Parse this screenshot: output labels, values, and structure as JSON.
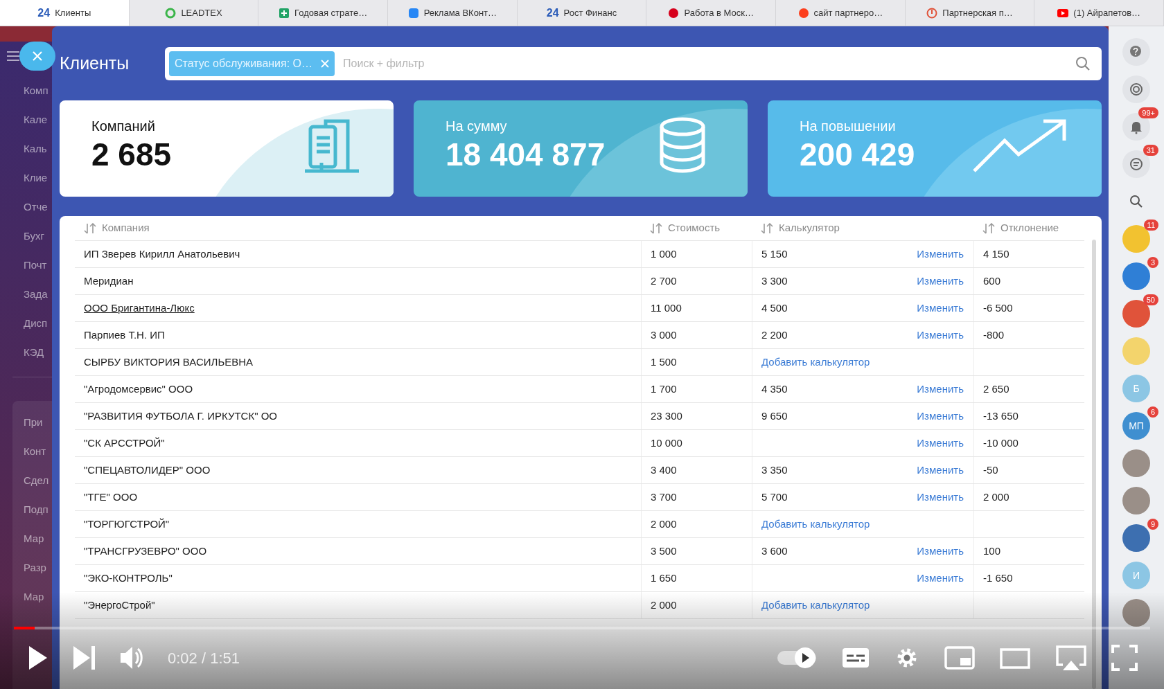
{
  "browser_tabs": [
    {
      "label": "Клиенты",
      "kind": "b24",
      "icon_text": "24",
      "selected": true
    },
    {
      "label": "LEADTEX",
      "kind": "ring",
      "selected": false
    },
    {
      "label": "Годовая страте…",
      "kind": "sheet",
      "selected": false
    },
    {
      "label": "Реклама ВКонт…",
      "kind": "vk",
      "selected": false
    },
    {
      "label": "Рост Финанс",
      "kind": "b24",
      "icon_text": "24",
      "selected": false
    },
    {
      "label": "Работа в Моск…",
      "kind": "hh",
      "selected": false
    },
    {
      "label": "сайт партнеро…",
      "kind": "yandex",
      "selected": false
    },
    {
      "label": "Партнерская п…",
      "kind": "partner",
      "selected": false
    },
    {
      "label": "(1) Айрапетов…",
      "kind": "youtube",
      "selected": false
    }
  ],
  "sidebar": {
    "groups": [
      {
        "kind": "main",
        "items": [
          "Комп",
          "Кале",
          "Каль",
          "Клие",
          "Отче",
          "Бухг",
          "Почт",
          "Зада",
          "Дисп",
          "КЭД"
        ]
      },
      {
        "kind": "boxed",
        "items": [
          "При",
          "Конт",
          "Сдел",
          "Подп",
          "Мар",
          "Разр",
          "Мар"
        ]
      }
    ]
  },
  "panel": {
    "title": "Клиенты",
    "filter_chip": "Статус обслуживания: О…",
    "search": {
      "placeholder": "Поиск + фильтр"
    }
  },
  "cards": [
    {
      "kind": "companies",
      "label": "Компаний",
      "value": "2 685"
    },
    {
      "kind": "sum",
      "label": "На сумму",
      "value": "18 404 877"
    },
    {
      "kind": "growth",
      "label": "На повышении",
      "value": "200 429"
    }
  ],
  "table": {
    "columns": [
      "Компания",
      "Стоимость",
      "Калькулятор",
      "Отклонение"
    ],
    "rows": [
      {
        "company": "ИП Зверев Кирилл Анатольевич",
        "cost": "1 000",
        "calculator": {
          "kind": "edit",
          "value": "5 150",
          "action": "Изменить"
        },
        "deviation": "4 150",
        "hovered": false
      },
      {
        "company": "Меридиан",
        "cost": "2 700",
        "calculator": {
          "kind": "edit",
          "value": "3 300",
          "action": "Изменить"
        },
        "deviation": "600",
        "hovered": false
      },
      {
        "company": "ООО Бригантина-Люкс",
        "cost": "11 000",
        "calculator": {
          "kind": "edit",
          "value": "4 500",
          "action": "Изменить"
        },
        "deviation": "-6 500",
        "hovered": true
      },
      {
        "company": "Парпиев Т.Н. ИП",
        "cost": "3 000",
        "calculator": {
          "kind": "edit",
          "value": "2 200",
          "action": "Изменить"
        },
        "deviation": "-800",
        "hovered": false
      },
      {
        "company": "СЫРБУ ВИКТОРИЯ ВАСИЛЬЕВНА",
        "cost": "1 500",
        "calculator": {
          "kind": "add",
          "action": "Добавить калькулятор"
        },
        "hovered": false
      },
      {
        "company": "\"Агродомсервис\" ООО",
        "cost": "1 700",
        "calculator": {
          "kind": "edit",
          "value": "4 350",
          "action": "Изменить"
        },
        "deviation": "2 650",
        "hovered": false
      },
      {
        "company": "\"РАЗВИТИЯ ФУТБОЛА Г. ИРКУТСК\" ОО",
        "cost": "23 300",
        "calculator": {
          "kind": "edit",
          "value": "9 650",
          "action": "Изменить"
        },
        "deviation": "-13 650",
        "hovered": false
      },
      {
        "company": "\"СК АРССТРОЙ\"",
        "cost": "10 000",
        "calculator": {
          "kind": "edit",
          "action": "Изменить"
        },
        "deviation": "-10 000",
        "hovered": false
      },
      {
        "company": "\"СПЕЦАВТОЛИДЕР\" ООО",
        "cost": "3 400",
        "calculator": {
          "kind": "edit",
          "value": "3 350",
          "action": "Изменить"
        },
        "deviation": "-50",
        "hovered": false
      },
      {
        "company": "\"ТГЕ\" ООО",
        "cost": "3 700",
        "calculator": {
          "kind": "edit",
          "value": "5 700",
          "action": "Изменить"
        },
        "deviation": "2 000",
        "hovered": false
      },
      {
        "company": "\"ТОРГЮГСТРОЙ\"",
        "cost": "2 000",
        "calculator": {
          "kind": "add",
          "action": "Добавить калькулятор"
        },
        "hovered": false
      },
      {
        "company": "\"ТРАНСГРУЗЕВРО\" ООО",
        "cost": "3 500",
        "calculator": {
          "kind": "edit",
          "value": "3 600",
          "action": "Изменить"
        },
        "deviation": "100",
        "hovered": false
      },
      {
        "company": "\"ЭКО-КОНТРОЛЬ\"",
        "cost": "1 650",
        "calculator": {
          "kind": "edit",
          "action": "Изменить"
        },
        "deviation": "-1 650",
        "hovered": false
      },
      {
        "company": "\"ЭнергоСтрой\"",
        "cost": "2 000",
        "calculator": {
          "kind": "add",
          "action": "Добавить калькулятор"
        },
        "hovered": false
      }
    ]
  },
  "right_bar": [
    {
      "kind": "help"
    },
    {
      "kind": "target"
    },
    {
      "kind": "bell",
      "badge": "99+"
    },
    {
      "kind": "chat",
      "badge": "31"
    },
    {
      "kind": "search"
    },
    {
      "kind": "avatar",
      "color": "#f2c230",
      "badge": "11"
    },
    {
      "kind": "avatar",
      "color": "#2f7fd6",
      "badge": "3"
    },
    {
      "kind": "avatar",
      "color": "#e0533a",
      "badge": "50"
    },
    {
      "kind": "avatar",
      "color": "#f3d46c"
    },
    {
      "kind": "initials",
      "text": "Б",
      "color": "#8cc6e4"
    },
    {
      "kind": "initials",
      "text": "МП",
      "color": "#3f8fd0",
      "badge": "6"
    },
    {
      "kind": "photo"
    },
    {
      "kind": "photo"
    },
    {
      "kind": "avatar",
      "color": "#3d6fb0",
      "badge": "9"
    },
    {
      "kind": "initials",
      "text": "И",
      "color": "#8cc6e4"
    },
    {
      "kind": "photo"
    }
  ],
  "player": {
    "level": 0.018,
    "time": "0:02 / 1:51",
    "autoplay_on": true
  }
}
